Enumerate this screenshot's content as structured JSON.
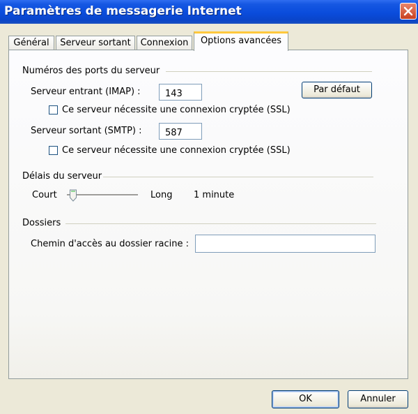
{
  "window": {
    "title": "Paramètres de messagerie Internet"
  },
  "tabs": [
    {
      "label": "Général"
    },
    {
      "label": "Serveur sortant"
    },
    {
      "label": "Connexion"
    },
    {
      "label": "Options avancées",
      "active": true
    }
  ],
  "ports": {
    "heading": "Numéros des ports du serveur",
    "incoming_label": "Serveur entrant (IMAP) :",
    "incoming_value": "143",
    "incoming_ssl_label": "Ce serveur nécessite une connexion cryptée (SSL)",
    "incoming_ssl_checked": false,
    "default_button": "Par défaut",
    "outgoing_label": "Serveur sortant (SMTP) :",
    "outgoing_value": "587",
    "outgoing_ssl_label": "Ce serveur nécessite une connexion cryptée (SSL)",
    "outgoing_ssl_checked": false
  },
  "timeouts": {
    "heading": "Délais du serveur",
    "short_label": "Court",
    "long_label": "Long",
    "value_text": "1 minute",
    "slider_fraction": 0.0
  },
  "folders": {
    "heading": "Dossiers",
    "root_path_label": "Chemin d'accès au dossier racine :",
    "root_path_value": ""
  },
  "footer": {
    "ok_label": "OK",
    "cancel_label": "Annuler"
  },
  "colors": {
    "title_bar": "#0a4cdc",
    "dialog_face": "#ece9d8",
    "active_tab_highlight": "#ffc83c",
    "close_button": "#c8401f"
  }
}
